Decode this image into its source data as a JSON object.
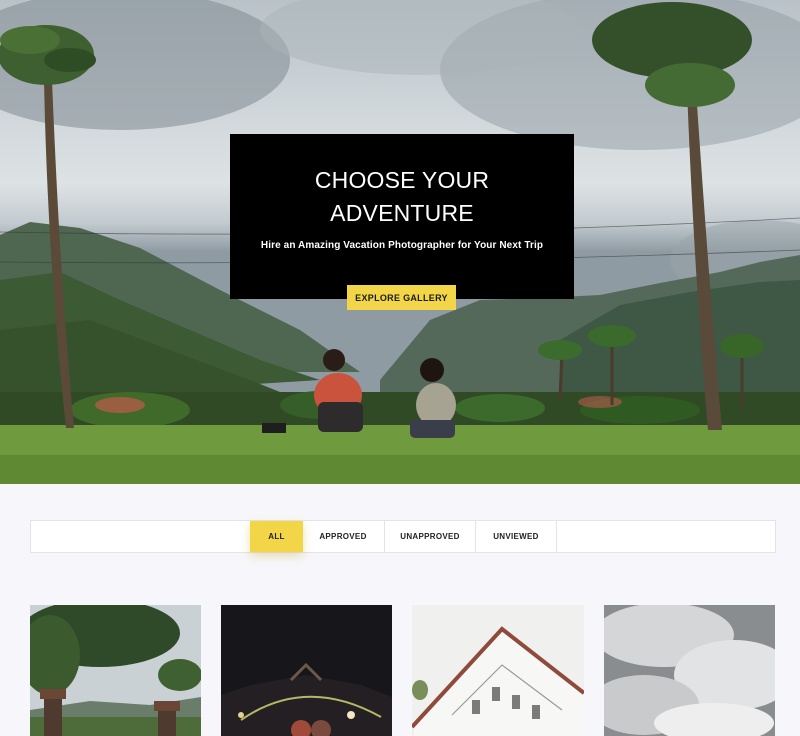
{
  "hero": {
    "title_line1": "CHOOSE YOUR",
    "title_line2": "ADVENTURE",
    "subtitle": "Hire an Amazing Vacation Photographer for Your Next Trip",
    "cta_label": "EXPLORE GALLERY"
  },
  "filters": {
    "tabs": [
      {
        "label": "ALL",
        "active": true
      },
      {
        "label": "APPROVED",
        "active": false
      },
      {
        "label": "UNAPPROVED",
        "active": false
      },
      {
        "label": "UNVIEWED",
        "active": false
      }
    ]
  },
  "gallery": {
    "items": [
      {
        "subject": "tropical-garden-photo"
      },
      {
        "subject": "night-bridge-lights-photo"
      },
      {
        "subject": "white-building-photo"
      },
      {
        "subject": "cloudy-sky-photo"
      }
    ]
  },
  "colors": {
    "accent": "#f2d648",
    "hero_box": "#000000",
    "page_background": "#f7f7fb"
  }
}
